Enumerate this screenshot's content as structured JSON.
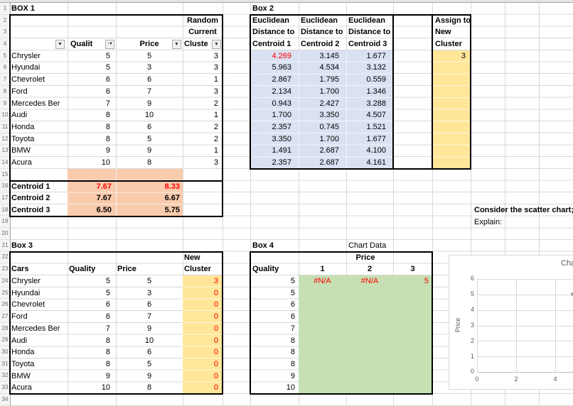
{
  "sheet": {
    "row_numbers": [
      "1",
      "2",
      "3",
      "4",
      "5",
      "6",
      "7",
      "8",
      "9",
      "10",
      "11",
      "12",
      "13",
      "14",
      "15",
      "16",
      "17",
      "18",
      "19",
      "20",
      "21",
      "22",
      "23",
      "24",
      "25",
      "26",
      "27",
      "28",
      "29",
      "30",
      "31",
      "32",
      "33",
      "34"
    ]
  },
  "icons": {
    "filter_dropdown": "▼",
    "sort_filter": "↑▼"
  },
  "colors": {
    "fill_blue": "#D9E1F2",
    "fill_yellow": "#FFE699",
    "fill_peach": "#F8CBAD",
    "fill_green": "#C6E0B4",
    "red_text": "#FF0000"
  },
  "box1": {
    "title": "BOX 1",
    "random_label": "Random",
    "current_label": "Current",
    "headers": {
      "quality": "Qualit",
      "price": "Price",
      "cluster": "Cluste"
    },
    "rows": [
      {
        "name": "Chrysler",
        "quality": "5",
        "price": "5",
        "cluster": "3"
      },
      {
        "name": "Hyundai",
        "quality": "5",
        "price": "3",
        "cluster": "3"
      },
      {
        "name": "Chevrolet",
        "quality": "6",
        "price": "6",
        "cluster": "1"
      },
      {
        "name": "Ford",
        "quality": "6",
        "price": "7",
        "cluster": "3"
      },
      {
        "name": "Mercedes Ber",
        "quality": "7",
        "price": "9",
        "cluster": "2"
      },
      {
        "name": "Audi",
        "quality": "8",
        "price": "10",
        "cluster": "1"
      },
      {
        "name": "Honda",
        "quality": "8",
        "price": "6",
        "cluster": "2"
      },
      {
        "name": "Toyota",
        "quality": "8",
        "price": "5",
        "cluster": "2"
      },
      {
        "name": "BMW",
        "quality": "9",
        "price": "9",
        "cluster": "1"
      },
      {
        "name": "Acura",
        "quality": "10",
        "price": "8",
        "cluster": "3"
      }
    ],
    "centroids": [
      {
        "label": "Centroid 1",
        "quality": "7.67",
        "price": "8.33"
      },
      {
        "label": "Centroid 2",
        "quality": "7.67",
        "price": "6.67"
      },
      {
        "label": "Centroid 3",
        "quality": "6.50",
        "price": "5.75"
      }
    ]
  },
  "box2": {
    "title": "Box 2",
    "h_r1c1": "Euclidean",
    "h_r1c2": "Euclidean",
    "h_r1c3": "Euclidean",
    "h_r2c1": "Distance to",
    "h_r2c2": "Distance to",
    "h_r2c3": "Distance to",
    "h_r3c1": "Centroid 1",
    "h_r3c2": "Centroid 2",
    "h_r3c3": "Centroid 3",
    "assign_r1": "Assign to",
    "assign_r2": "New",
    "assign_r3": "Cluster",
    "rows": [
      {
        "d1": "4.269",
        "d2": "3.145",
        "d3": "1.677",
        "assign": "3"
      },
      {
        "d1": "5.963",
        "d2": "4.534",
        "d3": "3.132",
        "assign": ""
      },
      {
        "d1": "2.867",
        "d2": "1.795",
        "d3": "0.559",
        "assign": ""
      },
      {
        "d1": "2.134",
        "d2": "1.700",
        "d3": "1.346",
        "assign": ""
      },
      {
        "d1": "0.943",
        "d2": "2.427",
        "d3": "3.288",
        "assign": ""
      },
      {
        "d1": "1.700",
        "d2": "3.350",
        "d3": "4.507",
        "assign": ""
      },
      {
        "d1": "2.357",
        "d2": "0.745",
        "d3": "1.521",
        "assign": ""
      },
      {
        "d1": "3.350",
        "d2": "1.700",
        "d3": "1.677",
        "assign": ""
      },
      {
        "d1": "1.491",
        "d2": "2.687",
        "d3": "4.100",
        "assign": ""
      },
      {
        "d1": "2.357",
        "d2": "2.687",
        "d3": "4.161",
        "assign": ""
      }
    ]
  },
  "notes": {
    "line1": "Consider the scatter chart; she",
    "line2": "Explain:"
  },
  "box3": {
    "title": "Box 3",
    "new_label": "New",
    "headers": {
      "cars": "Cars",
      "quality": "Quality",
      "price": "Price",
      "cluster": "Cluster"
    },
    "rows": [
      {
        "name": "Chrysler",
        "quality": "5",
        "price": "5",
        "cluster": "3"
      },
      {
        "name": "Hyundai",
        "quality": "5",
        "price": "3",
        "cluster": "0"
      },
      {
        "name": "Chevrolet",
        "quality": "6",
        "price": "6",
        "cluster": "0"
      },
      {
        "name": "Ford",
        "quality": "6",
        "price": "7",
        "cluster": "0"
      },
      {
        "name": "Mercedes Ber",
        "quality": "7",
        "price": "9",
        "cluster": "0"
      },
      {
        "name": "Audi",
        "quality": "8",
        "price": "10",
        "cluster": "0"
      },
      {
        "name": "Honda",
        "quality": "8",
        "price": "6",
        "cluster": "0"
      },
      {
        "name": "Toyota",
        "quality": "8",
        "price": "5",
        "cluster": "0"
      },
      {
        "name": "BMW",
        "quality": "9",
        "price": "9",
        "cluster": "0"
      },
      {
        "name": "Acura",
        "quality": "10",
        "price": "8",
        "cluster": "0"
      }
    ]
  },
  "box4": {
    "title": "Box 4",
    "chart_data_label": "Chart Data",
    "price_label": "Price",
    "headers": {
      "quality": "Quality",
      "c1": "1",
      "c2": "2",
      "c3": "3"
    },
    "rows": [
      {
        "quality": "5",
        "c1": "#N/A",
        "c2": "#N/A",
        "c3": "5"
      },
      {
        "quality": "5",
        "c1": "",
        "c2": "",
        "c3": ""
      },
      {
        "quality": "6",
        "c1": "",
        "c2": "",
        "c3": ""
      },
      {
        "quality": "6",
        "c1": "",
        "c2": "",
        "c3": ""
      },
      {
        "quality": "7",
        "c1": "",
        "c2": "",
        "c3": ""
      },
      {
        "quality": "8",
        "c1": "",
        "c2": "",
        "c3": ""
      },
      {
        "quality": "8",
        "c1": "",
        "c2": "",
        "c3": ""
      },
      {
        "quality": "8",
        "c1": "",
        "c2": "",
        "c3": ""
      },
      {
        "quality": "9",
        "c1": "",
        "c2": "",
        "c3": ""
      },
      {
        "quality": "10",
        "c1": "",
        "c2": "",
        "c3": ""
      }
    ]
  },
  "chart": {
    "title": "Cha",
    "ylabel": "Price",
    "y_ticks": [
      "6",
      "5",
      "4",
      "3",
      "2",
      "1",
      "0"
    ],
    "x_ticks": [
      "0",
      "2",
      "4"
    ]
  },
  "chart_data": {
    "type": "scatter",
    "title": "Cha",
    "xlabel": "",
    "ylabel": "Price",
    "ylim": [
      0,
      6
    ],
    "x_ticks_visible": [
      0,
      2,
      4
    ],
    "grid": true,
    "points": [
      {
        "x": 5,
        "y": 5
      }
    ]
  }
}
